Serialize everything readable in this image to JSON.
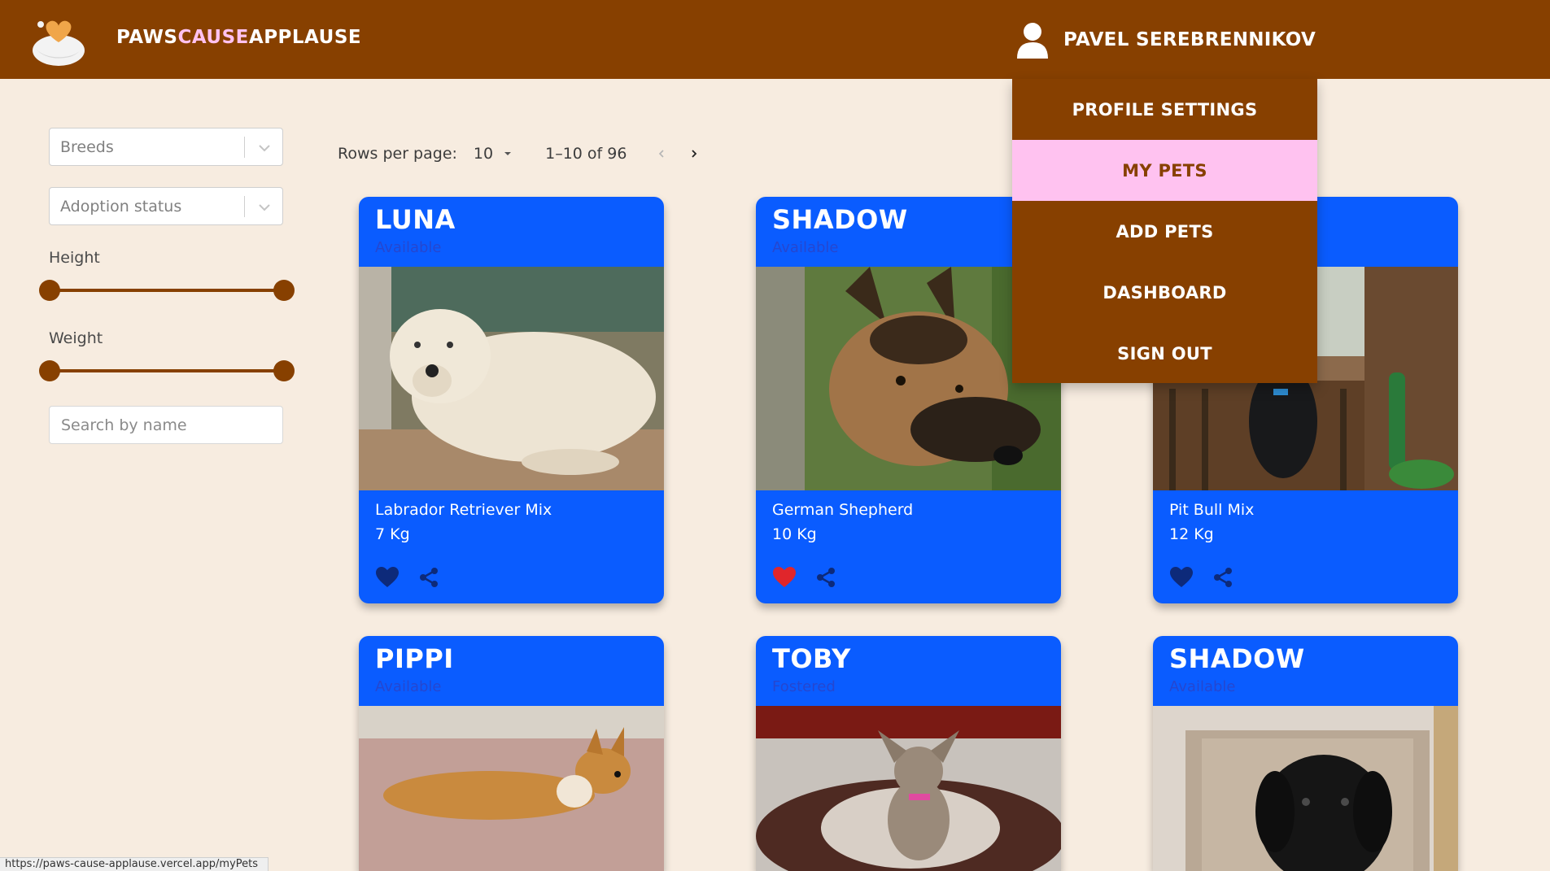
{
  "brand": {
    "part1": "PAWS",
    "part2": "CAUSE",
    "part3": "APPLAUSE"
  },
  "user": {
    "name": "PAVEL SEREBRENNIKOV"
  },
  "menu": {
    "items": [
      {
        "label": "PROFILE SETTINGS"
      },
      {
        "label": "MY PETS",
        "active": true
      },
      {
        "label": "ADD PETS"
      },
      {
        "label": "DASHBOARD"
      },
      {
        "label": "SIGN OUT"
      }
    ]
  },
  "filters": {
    "breeds_placeholder": "Breeds",
    "adoption_placeholder": "Adoption status",
    "height_label": "Height",
    "weight_label": "Weight",
    "search_placeholder": "Search by name"
  },
  "pagination": {
    "rows_label": "Rows per page:",
    "rows_value": "10",
    "range": "1–10 of 96"
  },
  "cards": [
    {
      "name": "LUNA",
      "status": "Available",
      "breed": "Labrador Retriever Mix",
      "weight": "7 Kg",
      "favorited": false
    },
    {
      "name": "SHADOW",
      "status": "Available",
      "breed": "German Shepherd",
      "weight": "10 Kg",
      "favorited": true
    },
    {
      "name": "",
      "status": "",
      "breed": "Pit Bull Mix",
      "weight": "12 Kg",
      "favorited": false
    },
    {
      "name": "PIPPI",
      "status": "Available",
      "breed": "",
      "weight": "",
      "favorited": false
    },
    {
      "name": "TOBY",
      "status": "Fostered",
      "breed": "",
      "weight": "",
      "favorited": false
    },
    {
      "name": "SHADOW",
      "status": "Available",
      "breed": "",
      "weight": "",
      "favorited": false
    }
  ],
  "colors": {
    "header": "#874000",
    "accent_pink": "#ffc2f0",
    "card_blue": "#0a5cff",
    "page_bg": "#f7ece0",
    "fav_active": "#e0262b",
    "fav_inactive": "#0d2a7a"
  },
  "status_url": "https://paws-cause-applause.vercel.app/myPets"
}
